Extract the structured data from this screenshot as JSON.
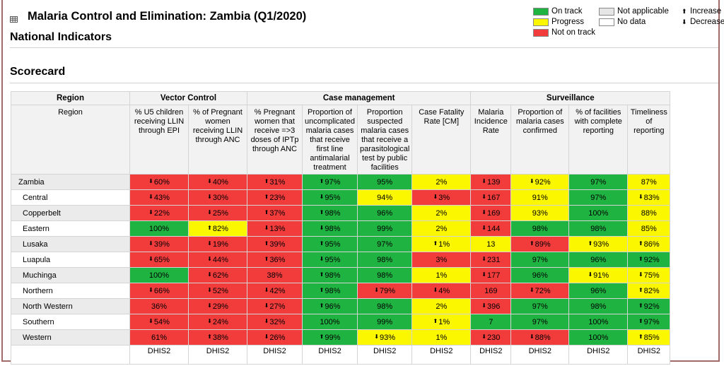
{
  "header": {
    "title": "Malaria Control and Elimination: Zambia (Q1/2020)",
    "subtitle": "National Indicators",
    "section_title": "Scorecard",
    "icon": "table-icon"
  },
  "legend": {
    "colors": {
      "on_track": "#1fb341",
      "progress": "#fbf700",
      "not_on_track": "#f23c3c",
      "not_applicable": "#e6e6e6",
      "no_data": "#ffffff"
    },
    "items": [
      {
        "label": "On track",
        "color": "#1fb341"
      },
      {
        "label": "Progress",
        "color": "#fbf700"
      },
      {
        "label": "Not on track",
        "color": "#f23c3c"
      },
      {
        "label": "Not applicable",
        "color": "#e6e6e6"
      },
      {
        "label": "No data",
        "color": "#ffffff"
      }
    ],
    "trends": [
      {
        "label": "Increase",
        "glyph": "🠉"
      },
      {
        "label": "Decrease",
        "glyph": "🠋"
      }
    ],
    "arrow_up": "⬆",
    "arrow_down": "⬇"
  },
  "table": {
    "groups": [
      {
        "label": "Region",
        "span": 1
      },
      {
        "label": "Vector Control",
        "span": 2
      },
      {
        "label": "Case management",
        "span": 4
      },
      {
        "label": "Surveillance",
        "span": 4
      }
    ],
    "columns": [
      "Region",
      "% U5 children receiving LLIN through EPI",
      "% of Pregnant women receiving LLIN through ANC",
      "% Pregnant women that receive =>3 doses of IPTp through ANC",
      "Proportion of uncomplicated malaria cases that receive first line antimalarial treatment",
      "Proportion suspected malaria cases that receive a parasitological test by public facilities",
      "Case Fatality Rate [CM]",
      "Malaria Incidence Rate",
      "Proportion of malaria cases confirmed",
      "% of facilities with complete reporting",
      "Timeliness of reporting"
    ],
    "rows": [
      {
        "region": "Zambia",
        "cells": [
          {
            "v": "60%",
            "s": "red",
            "t": "down"
          },
          {
            "v": "40%",
            "s": "red",
            "t": "down"
          },
          {
            "v": "31%",
            "s": "red",
            "t": "up"
          },
          {
            "v": "97%",
            "s": "green",
            "t": "up"
          },
          {
            "v": "95%",
            "s": "green",
            "t": ""
          },
          {
            "v": "2%",
            "s": "yellow",
            "t": ""
          },
          {
            "v": "139",
            "s": "red",
            "t": "down"
          },
          {
            "v": "92%",
            "s": "yellow",
            "t": "down"
          },
          {
            "v": "97%",
            "s": "green",
            "t": ""
          },
          {
            "v": "87%",
            "s": "yellow",
            "t": ""
          }
        ]
      },
      {
        "region": "Central",
        "cells": [
          {
            "v": "43%",
            "s": "red",
            "t": "down"
          },
          {
            "v": "30%",
            "s": "red",
            "t": "down"
          },
          {
            "v": "23%",
            "s": "red",
            "t": "up"
          },
          {
            "v": "95%",
            "s": "green",
            "t": "down"
          },
          {
            "v": "94%",
            "s": "yellow",
            "t": ""
          },
          {
            "v": "3%",
            "s": "red",
            "t": "down"
          },
          {
            "v": "167",
            "s": "red",
            "t": "down"
          },
          {
            "v": "91%",
            "s": "yellow",
            "t": ""
          },
          {
            "v": "97%",
            "s": "green",
            "t": ""
          },
          {
            "v": "83%",
            "s": "yellow",
            "t": "down"
          }
        ]
      },
      {
        "region": "Copperbelt",
        "cells": [
          {
            "v": "22%",
            "s": "red",
            "t": "down"
          },
          {
            "v": "25%",
            "s": "red",
            "t": "down"
          },
          {
            "v": "37%",
            "s": "red",
            "t": "up"
          },
          {
            "v": "98%",
            "s": "green",
            "t": "up"
          },
          {
            "v": "96%",
            "s": "green",
            "t": ""
          },
          {
            "v": "2%",
            "s": "yellow",
            "t": ""
          },
          {
            "v": "169",
            "s": "red",
            "t": "down"
          },
          {
            "v": "93%",
            "s": "yellow",
            "t": ""
          },
          {
            "v": "100%",
            "s": "green",
            "t": ""
          },
          {
            "v": "88%",
            "s": "yellow",
            "t": ""
          }
        ]
      },
      {
        "region": "Eastern",
        "cells": [
          {
            "v": "100%",
            "s": "green",
            "t": ""
          },
          {
            "v": "82%",
            "s": "yellow",
            "t": "up"
          },
          {
            "v": "13%",
            "s": "red",
            "t": "down"
          },
          {
            "v": "98%",
            "s": "green",
            "t": "down"
          },
          {
            "v": "99%",
            "s": "green",
            "t": ""
          },
          {
            "v": "2%",
            "s": "yellow",
            "t": ""
          },
          {
            "v": "144",
            "s": "red",
            "t": "down"
          },
          {
            "v": "98%",
            "s": "green",
            "t": ""
          },
          {
            "v": "98%",
            "s": "green",
            "t": ""
          },
          {
            "v": "85%",
            "s": "yellow",
            "t": ""
          }
        ]
      },
      {
        "region": "Lusaka",
        "cells": [
          {
            "v": "39%",
            "s": "red",
            "t": "down"
          },
          {
            "v": "19%",
            "s": "red",
            "t": "down"
          },
          {
            "v": "39%",
            "s": "red",
            "t": "up"
          },
          {
            "v": "95%",
            "s": "green",
            "t": "up"
          },
          {
            "v": "97%",
            "s": "green",
            "t": ""
          },
          {
            "v": "1%",
            "s": "yellow",
            "t": "up"
          },
          {
            "v": "13",
            "s": "yellow",
            "t": ""
          },
          {
            "v": "89%",
            "s": "red",
            "t": "up"
          },
          {
            "v": "93%",
            "s": "yellow",
            "t": "up"
          },
          {
            "v": "86%",
            "s": "yellow",
            "t": "up"
          }
        ]
      },
      {
        "region": "Luapula",
        "cells": [
          {
            "v": "65%",
            "s": "red",
            "t": "down"
          },
          {
            "v": "44%",
            "s": "red",
            "t": "down"
          },
          {
            "v": "36%",
            "s": "red",
            "t": "up"
          },
          {
            "v": "95%",
            "s": "green",
            "t": "down"
          },
          {
            "v": "98%",
            "s": "green",
            "t": ""
          },
          {
            "v": "3%",
            "s": "red",
            "t": ""
          },
          {
            "v": "231",
            "s": "red",
            "t": "down"
          },
          {
            "v": "97%",
            "s": "green",
            "t": ""
          },
          {
            "v": "96%",
            "s": "green",
            "t": ""
          },
          {
            "v": "92%",
            "s": "green",
            "t": "up"
          }
        ]
      },
      {
        "region": "Muchinga",
        "cells": [
          {
            "v": "100%",
            "s": "green",
            "t": ""
          },
          {
            "v": "62%",
            "s": "red",
            "t": "down"
          },
          {
            "v": "38%",
            "s": "red",
            "t": ""
          },
          {
            "v": "98%",
            "s": "green",
            "t": "up"
          },
          {
            "v": "98%",
            "s": "green",
            "t": ""
          },
          {
            "v": "1%",
            "s": "yellow",
            "t": ""
          },
          {
            "v": "177",
            "s": "red",
            "t": "down"
          },
          {
            "v": "96%",
            "s": "green",
            "t": ""
          },
          {
            "v": "91%",
            "s": "yellow",
            "t": "down"
          },
          {
            "v": "75%",
            "s": "yellow",
            "t": "down"
          }
        ]
      },
      {
        "region": "Northern",
        "cells": [
          {
            "v": "66%",
            "s": "red",
            "t": "down"
          },
          {
            "v": "52%",
            "s": "red",
            "t": "down"
          },
          {
            "v": "42%",
            "s": "red",
            "t": "down"
          },
          {
            "v": "98%",
            "s": "green",
            "t": "up"
          },
          {
            "v": "79%",
            "s": "red",
            "t": "down"
          },
          {
            "v": "4%",
            "s": "red",
            "t": "down"
          },
          {
            "v": "169",
            "s": "red",
            "t": ""
          },
          {
            "v": "72%",
            "s": "red",
            "t": "down"
          },
          {
            "v": "96%",
            "s": "green",
            "t": ""
          },
          {
            "v": "82%",
            "s": "yellow",
            "t": "up"
          }
        ]
      },
      {
        "region": "North Western",
        "cells": [
          {
            "v": "36%",
            "s": "red",
            "t": ""
          },
          {
            "v": "29%",
            "s": "red",
            "t": "down"
          },
          {
            "v": "27%",
            "s": "red",
            "t": "down"
          },
          {
            "v": "96%",
            "s": "green",
            "t": "up"
          },
          {
            "v": "98%",
            "s": "green",
            "t": ""
          },
          {
            "v": "2%",
            "s": "yellow",
            "t": ""
          },
          {
            "v": "396",
            "s": "red",
            "t": "down"
          },
          {
            "v": "97%",
            "s": "green",
            "t": ""
          },
          {
            "v": "98%",
            "s": "green",
            "t": ""
          },
          {
            "v": "92%",
            "s": "green",
            "t": "up"
          }
        ]
      },
      {
        "region": "Southern",
        "cells": [
          {
            "v": "54%",
            "s": "red",
            "t": "down"
          },
          {
            "v": "24%",
            "s": "red",
            "t": "down"
          },
          {
            "v": "32%",
            "s": "red",
            "t": "down"
          },
          {
            "v": "100%",
            "s": "green",
            "t": ""
          },
          {
            "v": "99%",
            "s": "green",
            "t": ""
          },
          {
            "v": "1%",
            "s": "yellow",
            "t": "up"
          },
          {
            "v": "7",
            "s": "green",
            "t": ""
          },
          {
            "v": "97%",
            "s": "green",
            "t": ""
          },
          {
            "v": "100%",
            "s": "green",
            "t": ""
          },
          {
            "v": "97%",
            "s": "green",
            "t": "up"
          }
        ]
      },
      {
        "region": "Western",
        "cells": [
          {
            "v": "61%",
            "s": "red",
            "t": ""
          },
          {
            "v": "38%",
            "s": "red",
            "t": "up"
          },
          {
            "v": "26%",
            "s": "red",
            "t": "down"
          },
          {
            "v": "99%",
            "s": "green",
            "t": "up"
          },
          {
            "v": "93%",
            "s": "yellow",
            "t": "down"
          },
          {
            "v": "1%",
            "s": "yellow",
            "t": ""
          },
          {
            "v": "230",
            "s": "red",
            "t": "down"
          },
          {
            "v": "88%",
            "s": "red",
            "t": "down"
          },
          {
            "v": "100%",
            "s": "green",
            "t": ""
          },
          {
            "v": "85%",
            "s": "yellow",
            "t": "up"
          }
        ]
      }
    ],
    "source_row": [
      "",
      "DHIS2",
      "DHIS2",
      "DHIS2",
      "DHIS2",
      "DHIS2",
      "DHIS2",
      "DHIS2",
      "DHIS2",
      "DHIS2",
      "DHIS2"
    ]
  }
}
